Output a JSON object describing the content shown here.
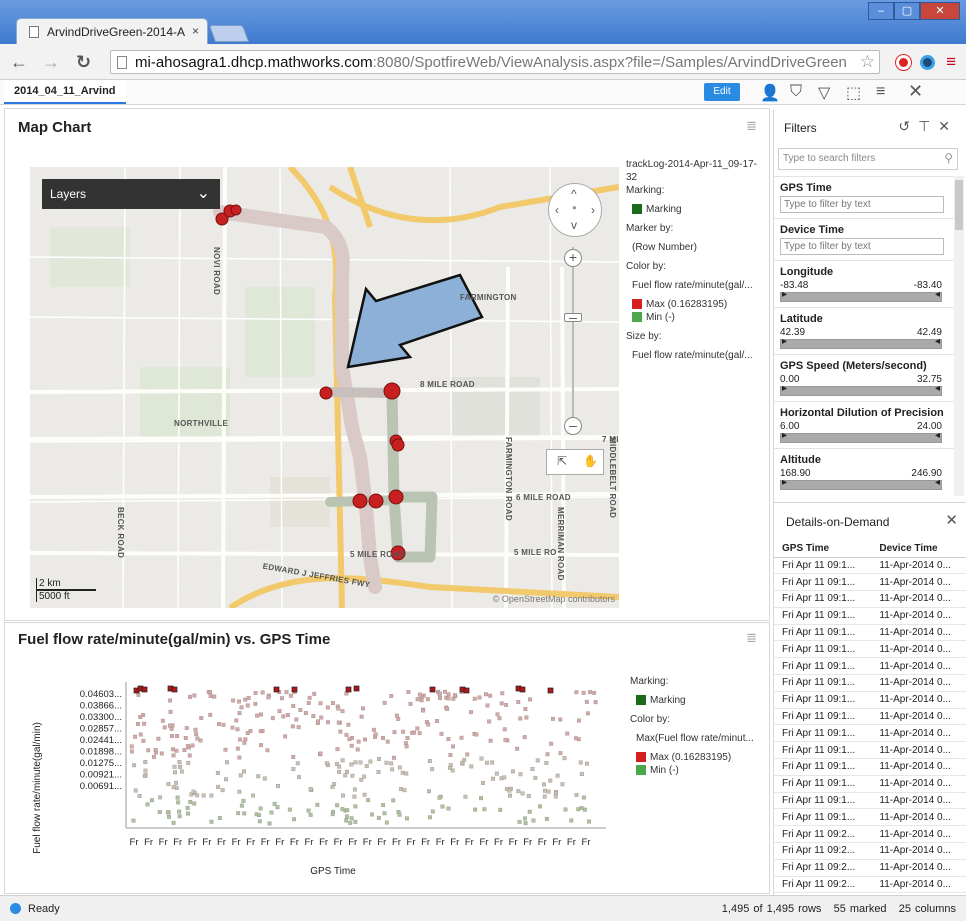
{
  "browser": {
    "tab_title": "ArvindDriveGreen-2014-A",
    "tab_close": "×",
    "url_host": "mi-ahosagra1.dhcp.mathworks.com",
    "url_rest": ":8080/SpotfireWeb/ViewAnalysis.aspx?file=/Samples/ArvindDriveGreen"
  },
  "toolbar": {
    "page_tab": "2014_04_11_Arvind",
    "edit_label": "Edit"
  },
  "map_chart": {
    "title": "Map Chart",
    "layers_label": "Layers",
    "osm_credit": "© OpenStreetMap contributors",
    "scale_km": "2 km",
    "scale_ft": "5000 ft",
    "place_labels": [
      "FARMINGTON",
      "NORTHVILLE",
      "8 MILE ROAD",
      "7 MI",
      "6 MILE ROAD",
      "5 MILE ROAD",
      "5 MILE RO",
      "NOVI ROAD",
      "BECK ROAD",
      "FARMINGTON ROAD",
      "MERRIMAN ROAD",
      "MIDDLEBELT ROAD",
      "EDWARD J JEFFRIES FWY"
    ],
    "legend": {
      "layer_name": "trackLog-2014-Apr-11_09-17-32",
      "marking_label": "Marking:",
      "marking_item": "Marking",
      "marker_by_label": "Marker by:",
      "marker_by_value": "(Row Number)",
      "color_by_label": "Color by:",
      "color_by_value": "Fuel flow rate/minute(gal/...",
      "max_label": "Max (0.16283195)",
      "min_label": "Min (-)",
      "size_by_label": "Size by:",
      "size_by_value": "Fuel flow rate/minute(gal/..."
    },
    "colors": {
      "marking": "#1b6b1b",
      "max": "#d42020",
      "min": "#4aa84a"
    }
  },
  "scatter_chart": {
    "title": "Fuel flow rate/minute(gal/min) vs. GPS Time",
    "legend": {
      "marking_label": "Marking:",
      "marking_item": "Marking",
      "color_by_label": "Color by:",
      "color_by_value": "Max(Fuel flow rate/minut...",
      "max_label": "Max (0.16283195)",
      "min_label": "Min (-)"
    }
  },
  "chart_data": {
    "type": "scatter",
    "title": "Fuel flow rate/minute(gal/min) vs. GPS Time",
    "xlabel": "GPS Time",
    "ylabel": "Fuel flow rate/minute(gal/min)",
    "y_tick_labels": [
      "0.04603...",
      "0.03866...",
      "0.03300...",
      "0.02857...",
      "0.02441...",
      "0.01898...",
      "0.01275...",
      "0.00921...",
      "0.00691..."
    ],
    "x_tick_labels": [
      "Fr",
      "Fr",
      "Fr",
      "Fr",
      "Fr",
      "Fr",
      "Fr",
      "Fr",
      "Fr",
      "Fr",
      "Fr",
      "Fr",
      "Fr",
      "Fr",
      "Fr",
      "Fr",
      "Fr",
      "Fr",
      "Fr",
      "Fr",
      "Fr",
      "Fr",
      "Fr",
      "Fr",
      "Fr",
      "Fr",
      "Fr",
      "Fr",
      "Fr",
      "Fr",
      "Fr",
      "Fr"
    ],
    "grid": false,
    "legend_position": "right"
  },
  "filters": {
    "title": "Filters",
    "search_placeholder": "Type to search filters",
    "items": [
      {
        "name": "GPS Time",
        "type": "text",
        "placeholder": "Type to filter by text"
      },
      {
        "name": "Device Time",
        "type": "text",
        "placeholder": "Type to filter by text"
      },
      {
        "name": "Longitude",
        "type": "range",
        "min": "-83.48",
        "max": "-83.40"
      },
      {
        "name": "Latitude",
        "type": "range",
        "min": "42.39",
        "max": "42.49"
      },
      {
        "name": "GPS Speed (Meters/second)",
        "type": "range",
        "min": "0.00",
        "max": "32.75"
      },
      {
        "name": "Horizontal Dilution of Precision",
        "type": "range",
        "min": "6.00",
        "max": "24.00"
      },
      {
        "name": "Altitude",
        "type": "range",
        "min": "168.90",
        "max": "246.90"
      }
    ]
  },
  "details": {
    "title": "Details-on-Demand",
    "columns": [
      "GPS Time",
      "Device Time"
    ],
    "rows": [
      [
        "Fri Apr 11 09:1...",
        "11-Apr-2014 0..."
      ],
      [
        "Fri Apr 11 09:1...",
        "11-Apr-2014 0..."
      ],
      [
        "Fri Apr 11 09:1...",
        "11-Apr-2014 0..."
      ],
      [
        "Fri Apr 11 09:1...",
        "11-Apr-2014 0..."
      ],
      [
        "Fri Apr 11 09:1...",
        "11-Apr-2014 0..."
      ],
      [
        "Fri Apr 11 09:1...",
        "11-Apr-2014 0..."
      ],
      [
        "Fri Apr 11 09:1...",
        "11-Apr-2014 0..."
      ],
      [
        "Fri Apr 11 09:1...",
        "11-Apr-2014 0..."
      ],
      [
        "Fri Apr 11 09:1...",
        "11-Apr-2014 0..."
      ],
      [
        "Fri Apr 11 09:1...",
        "11-Apr-2014 0..."
      ],
      [
        "Fri Apr 11 09:1...",
        "11-Apr-2014 0..."
      ],
      [
        "Fri Apr 11 09:1...",
        "11-Apr-2014 0..."
      ],
      [
        "Fri Apr 11 09:1...",
        "11-Apr-2014 0..."
      ],
      [
        "Fri Apr 11 09:1...",
        "11-Apr-2014 0..."
      ],
      [
        "Fri Apr 11 09:1...",
        "11-Apr-2014 0..."
      ],
      [
        "Fri Apr 11 09:1...",
        "11-Apr-2014 0..."
      ],
      [
        "Fri Apr 11 09:2...",
        "11-Apr-2014 0..."
      ],
      [
        "Fri Apr 11 09:2...",
        "11-Apr-2014 0..."
      ],
      [
        "Fri Apr 11 09:2...",
        "11-Apr-2014 0..."
      ],
      [
        "Fri Apr 11 09:2...",
        "11-Apr-2014 0..."
      ],
      [
        "Fri Apr 11 09:2...",
        "11-Apr-2014 0..."
      ]
    ]
  },
  "status": {
    "text": "Ready",
    "rows": "1,495 of 1,495 rows",
    "marked": "55 marked",
    "columns": "25 columns"
  },
  "icons": [
    "document-icon",
    "back-icon",
    "forward-icon",
    "reload-icon",
    "star-icon",
    "user-icon",
    "bookmark-icon",
    "filter-icon",
    "selection-icon",
    "menu-icon",
    "close-icon",
    "chevron-down-icon",
    "pan-icon",
    "pointer-icon",
    "reset-icon",
    "pin-icon",
    "search-icon"
  ]
}
